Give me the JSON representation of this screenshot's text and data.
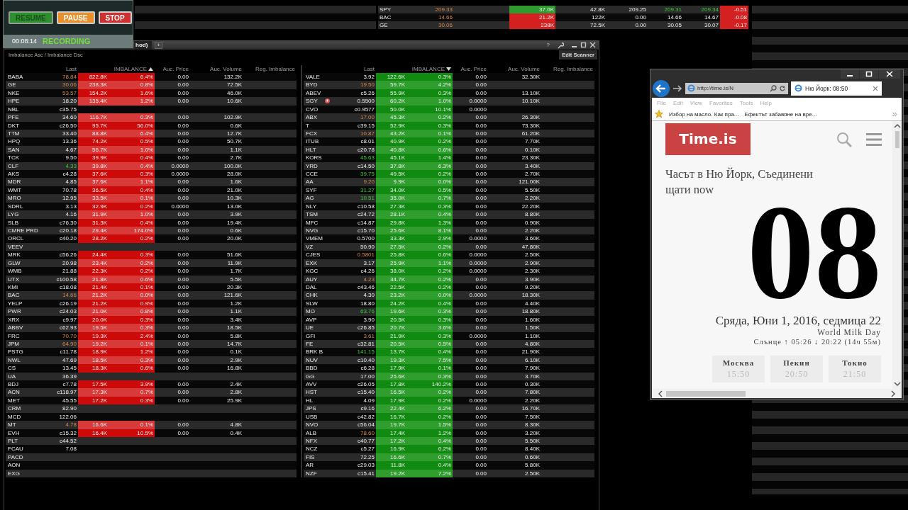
{
  "recorder": {
    "buttons": [
      {
        "label": "RESUME",
        "color": "#2f8f2f",
        "disabled": true
      },
      {
        "label": "PAUSE",
        "color": "#e8902a",
        "disabled": false
      },
      {
        "label": "STOP",
        "color": "#d03030",
        "disabled": false
      }
    ],
    "time": "00:08:14",
    "status": "RECORDING"
  },
  "ticker": {
    "rows": [
      {
        "column_1": "SPY",
        "column_2": "209.33",
        "last_down": true,
        "column_3": "37.0K",
        "buy": true,
        "column_4": "42.8K",
        "column_5": "209.25",
        "column_6": "209.31",
        "column_7": "209.34",
        "quote_up": true,
        "column_8": "-0.51"
      },
      {
        "column_1": "BAC",
        "column_2": "14.66",
        "last_down": true,
        "column_3": "21.2K",
        "buy": false,
        "column_4": "122K",
        "column_5": "0.00",
        "column_6": "14.66",
        "column_7": "14.67",
        "quote_up": false,
        "column_8": "-0.08"
      },
      {
        "column_1": "GE",
        "column_2": "30.06",
        "last_down": true,
        "column_3": "238K",
        "buy": false,
        "column_4": "72.5K",
        "column_5": "0.00",
        "column_6": "30.05",
        "column_7": "30.07",
        "quote_up": false,
        "column_8": "-0.17"
      }
    ]
  },
  "scanner": {
    "tab": "hod)",
    "new_tab": "+",
    "help": "?",
    "subtitle": "Imbalance Asc / Imbalance Dsc",
    "edit_button": "Edit Scanner",
    "tables": [
      {
        "columns": [
          "Last",
          "IMBALANCE",
          "Auc. Price",
          "Auc. Volume",
          "Reg. Imbalance"
        ],
        "ascending": true,
        "buy": false,
        "rows": [
          {
            "sym": "BABA",
            "last": "78.84",
            "up": false,
            "down": true,
            "imb": "822.8K",
            "pct": "6.4%",
            "price": "0.00",
            "vol": "132.2K"
          },
          {
            "sym": "GE",
            "last": "30.06",
            "up": false,
            "down": true,
            "imb": "238.3K",
            "pct": "0.8%",
            "price": "0.00",
            "vol": "72.5K"
          },
          {
            "sym": "NKE",
            "last": "53.57",
            "up": false,
            "down": true,
            "imb": "154.2K",
            "pct": "1.6%",
            "price": "0.00",
            "vol": "46.0K"
          },
          {
            "sym": "HPE",
            "last": "18.20",
            "up": false,
            "down": false,
            "imb": "135.4K",
            "pct": "1.2%",
            "price": "0.00",
            "vol": "10.6K"
          },
          {
            "sym": "NBL",
            "last": "c35.75",
            "up": false,
            "down": false
          },
          {
            "sym": "PFE",
            "last": "34.60",
            "up": false,
            "down": false,
            "imb": "116.7K",
            "pct": "0.3%",
            "price": "0.00",
            "vol": "102.9K"
          },
          {
            "sym": "DKT",
            "last": "c26.50",
            "up": false,
            "down": false,
            "imb": "95.7K",
            "pct": "56.0%",
            "price": "0.00",
            "vol": "0.6K"
          },
          {
            "sym": "TTM",
            "last": "33.40",
            "up": false,
            "down": false,
            "imb": "88.8K",
            "pct": "6.4%",
            "price": "0.00",
            "vol": "12.7K"
          },
          {
            "sym": "HPQ",
            "last": "13.36",
            "up": false,
            "down": false,
            "imb": "74.2K",
            "pct": "0.5%",
            "price": "0.00",
            "vol": "50.7K"
          },
          {
            "sym": "SAN",
            "last": "4.67",
            "up": false,
            "down": false,
            "imb": "56.7K",
            "pct": "1.0%",
            "price": "0.00",
            "vol": "1.1K"
          },
          {
            "sym": "TCK",
            "last": "9.50",
            "up": false,
            "down": false,
            "imb": "39.9K",
            "pct": "0.4%",
            "price": "0.00",
            "vol": "2.7K"
          },
          {
            "sym": "CLF",
            "last": "4.33",
            "up": true,
            "down": false,
            "imb": "39.8K",
            "pct": "0.4%",
            "price": "0.0000",
            "vol": "100.0K"
          },
          {
            "sym": "AKS",
            "last": "c4.28",
            "up": false,
            "down": false,
            "imb": "37.6K",
            "pct": "0.3%",
            "price": "0.0000",
            "vol": "28.0K"
          },
          {
            "sym": "MDR",
            "last": "4.85",
            "up": false,
            "down": false,
            "imb": "37.6K",
            "pct": "1.1%",
            "price": "0.00",
            "vol": "1.6K"
          },
          {
            "sym": "WMT",
            "last": "70.78",
            "up": false,
            "down": false,
            "imb": "36.5K",
            "pct": "0.4%",
            "price": "0.00",
            "vol": "21.0K"
          },
          {
            "sym": "MRO",
            "last": "12.95",
            "up": false,
            "down": false,
            "imb": "33.5K",
            "pct": "0.1%",
            "price": "0.00",
            "vol": "10.3K"
          },
          {
            "sym": "SDRL",
            "last": "3.13",
            "up": false,
            "down": false,
            "imb": "32.9K",
            "pct": "0.2%",
            "price": "0.0000",
            "vol": "13.0K"
          },
          {
            "sym": "LYG",
            "last": "4.16",
            "up": false,
            "down": false,
            "imb": "31.9K",
            "pct": "1.0%",
            "price": "0.00",
            "vol": "3.9K"
          },
          {
            "sym": "SLB",
            "last": "c76.30",
            "up": false,
            "down": false,
            "imb": "31.3K",
            "pct": "0.4%",
            "price": "0.00",
            "vol": "19.4K"
          },
          {
            "sym": "CMRE PRD",
            "last": "c20.18",
            "up": false,
            "down": false,
            "imb": "29.4K",
            "pct": "174.0%",
            "price": "0.00",
            "vol": "0.6K"
          },
          {
            "sym": "ORCL",
            "last": "c40.20",
            "up": false,
            "down": false,
            "imb": "28.2K",
            "pct": "0.2%",
            "price": "0.00",
            "vol": "20.0K"
          },
          {
            "sym": "VEEV"
          },
          {
            "sym": "MRK",
            "last": "c56.26",
            "up": false,
            "down": false,
            "imb": "24.4K",
            "pct": "0.3%",
            "price": "0.00",
            "vol": "51.6K"
          },
          {
            "sym": "GLW",
            "last": "20.98",
            "up": false,
            "down": false,
            "imb": "23.4K",
            "pct": "0.2%",
            "price": "0.00",
            "vol": "11.9K"
          },
          {
            "sym": "WMB",
            "last": "21.88",
            "up": false,
            "down": false,
            "imb": "22.3K",
            "pct": "0.2%",
            "price": "0.00",
            "vol": "1.7K"
          },
          {
            "sym": "UTX",
            "last": "c100.58",
            "up": false,
            "down": false,
            "imb": "21.8K",
            "pct": "0.6%",
            "price": "0.00",
            "vol": "5.5K"
          },
          {
            "sym": "KMI",
            "last": "c18.08",
            "up": false,
            "down": false,
            "imb": "21.4K",
            "pct": "0.1%",
            "price": "0.00",
            "vol": "20.3K"
          },
          {
            "sym": "BAC",
            "last": "14.66",
            "up": false,
            "down": true,
            "imb": "21.2K",
            "pct": "0.0%",
            "price": "0.00",
            "vol": "121.6K"
          },
          {
            "sym": "YELP",
            "last": "c26.19",
            "up": false,
            "down": false,
            "imb": "21.2K",
            "pct": "0.9%",
            "price": "0.00",
            "vol": "1.2K"
          },
          {
            "sym": "PWR",
            "last": "c24.03",
            "up": false,
            "down": false,
            "imb": "21.0K",
            "pct": "0.8%",
            "price": "0.00",
            "vol": "1.1K"
          },
          {
            "sym": "XRX",
            "last": "c9.97",
            "up": false,
            "down": false,
            "imb": "20.0K",
            "pct": "0.3%",
            "price": "0.00",
            "vol": "3.4K"
          },
          {
            "sym": "ABBV",
            "last": "c62.93",
            "up": false,
            "down": false,
            "imb": "19.5K",
            "pct": "0.3%",
            "price": "0.00",
            "vol": "18.5K"
          },
          {
            "sym": "FRC",
            "last": "70.70",
            "up": false,
            "down": true,
            "imb": "19.3K",
            "pct": "2.4%",
            "price": "0.00",
            "vol": "5.8K"
          },
          {
            "sym": "JPM",
            "last": "64.90",
            "up": false,
            "down": true,
            "imb": "19.2K",
            "pct": "0.1%",
            "price": "0.00",
            "vol": "14.7K"
          },
          {
            "sym": "PSTG",
            "last": "c11.78",
            "up": false,
            "down": false,
            "imb": "18.9K",
            "pct": "1.2%",
            "price": "0.00",
            "vol": "0.1K"
          },
          {
            "sym": "NWL",
            "last": "47.69",
            "up": false,
            "down": false,
            "imb": "18.5K",
            "pct": "0.3%",
            "price": "0.00",
            "vol": "2.9K"
          },
          {
            "sym": "CS",
            "last": "13.45",
            "up": false,
            "down": false,
            "imb": "18.3K",
            "pct": "0.6%",
            "price": "0.00",
            "vol": "16.8K"
          },
          {
            "sym": "UA",
            "last": "36.39",
            "up": false,
            "down": false
          },
          {
            "sym": "BDJ",
            "last": "c7.78",
            "up": false,
            "down": false,
            "imb": "17.5K",
            "pct": "3.9%",
            "price": "0.00",
            "vol": "2.4K"
          },
          {
            "sym": "ACN",
            "last": "c118.97",
            "up": false,
            "down": false,
            "imb": "17.3K",
            "pct": "0.7%",
            "price": "0.00",
            "vol": "2.8K"
          },
          {
            "sym": "MET",
            "last": "45.55",
            "up": false,
            "down": false,
            "imb": "17.2K",
            "pct": "0.3%",
            "price": "0.00",
            "vol": "25.9K"
          },
          {
            "sym": "CRM",
            "last": "82.90",
            "up": false,
            "down": false
          },
          {
            "sym": "MCD",
            "last": "122.06",
            "up": false,
            "down": false
          },
          {
            "sym": "MT",
            "last": "4.78",
            "up": false,
            "down": true,
            "imb": "16.6K",
            "pct": "0.1%",
            "price": "0.00",
            "vol": "4.8K"
          },
          {
            "sym": "EVH",
            "last": "c15.32",
            "up": false,
            "down": false,
            "imb": "16.4K",
            "pct": "10.5%",
            "price": "0.00",
            "vol": "0.4K"
          },
          {
            "sym": "PLT",
            "last": "c44.52",
            "up": false,
            "down": false
          },
          {
            "sym": "FCAU",
            "last": "7.08",
            "up": false,
            "down": false
          },
          {
            "sym": "PACD"
          },
          {
            "sym": "AON"
          },
          {
            "sym": "EXG"
          }
        ]
      },
      {
        "columns": [
          "Last",
          "IMBALANCE",
          "Auc. Price",
          "Auc. Volume",
          "Reg. Imbalance"
        ],
        "ascending": false,
        "buy": true,
        "rows": [
          {
            "sym": "VALE",
            "last": "3.92",
            "up": false,
            "down": false,
            "imb": "122.6K",
            "pct": "0.3%",
            "price": "0.00",
            "vol": "32.30K"
          },
          {
            "sym": "BYD",
            "last": "19.50",
            "up": false,
            "down": true,
            "imb": "59.7K",
            "pct": "4.2%",
            "price": "0.00"
          },
          {
            "sym": "ABEV",
            "last": "c5.26",
            "up": false,
            "down": false,
            "imb": "55.9K",
            "pct": "0.3%",
            "price": "0.00",
            "vol": "13.10K"
          },
          {
            "sym": "SGY",
            "alert": true,
            "last": "0.5500",
            "up": false,
            "down": false,
            "imb": "60.2K",
            "pct": "1.0%",
            "price": "0.0000",
            "vol": "10.10K"
          },
          {
            "sym": "CVO",
            "last": "c0.9577",
            "up": false,
            "down": false,
            "imb": "50.0K",
            "pct": "10.1%",
            "price": "0.0000"
          },
          {
            "sym": "ABX",
            "last": "17.00",
            "up": false,
            "down": true,
            "imb": "45.3K",
            "pct": "0.2%",
            "price": "0.00",
            "vol": "26.30K"
          },
          {
            "sym": "T",
            "last": "c39.15",
            "up": false,
            "down": false,
            "imb": "52.9K",
            "pct": "0.3%",
            "price": "0.00",
            "vol": "73.30K"
          },
          {
            "sym": "FCX",
            "last": "10.87",
            "up": false,
            "down": true,
            "imb": "43.2K",
            "pct": "0.1%",
            "price": "0.00",
            "vol": "61.20K"
          },
          {
            "sym": "ITUB",
            "last": "c8.01",
            "up": false,
            "down": false,
            "imb": "40.9K",
            "pct": "0.2%",
            "price": "0.00",
            "vol": "7.70K"
          },
          {
            "sym": "HLT",
            "last": "c20.78",
            "up": false,
            "down": false,
            "imb": "40.8K",
            "pct": "0.6%",
            "price": "0.00",
            "vol": "0.10K"
          },
          {
            "sym": "KORS",
            "last": "45.63",
            "up": true,
            "down": false,
            "imb": "45.1K",
            "pct": "1.4%",
            "price": "0.00",
            "vol": "23.30K"
          },
          {
            "sym": "YRD",
            "last": "c14.50",
            "up": false,
            "down": false,
            "imb": "37.8K",
            "pct": "6.3%",
            "price": "0.00",
            "vol": "3.40K"
          },
          {
            "sym": "CCE",
            "last": "39.75",
            "up": true,
            "down": false,
            "imb": "49.5K",
            "pct": "0.2%",
            "price": "0.00",
            "vol": "2.70K"
          },
          {
            "sym": "AA",
            "last": "9.20",
            "up": false,
            "down": true,
            "imb": "9.9K",
            "pct": "0.0%",
            "price": "0.00",
            "vol": "121.00K"
          },
          {
            "sym": "SYF",
            "last": "31.27",
            "up": true,
            "down": false,
            "imb": "34.0K",
            "pct": "0.5%",
            "price": "0.00",
            "vol": "5.50K"
          },
          {
            "sym": "AG",
            "last": "10.51",
            "up": true,
            "down": false,
            "imb": "35.0K",
            "pct": "0.7%",
            "price": "0.00",
            "vol": "2.20K"
          },
          {
            "sym": "NLY",
            "last": "c10.58",
            "up": false,
            "down": false,
            "imb": "27.3K",
            "pct": "0.3%",
            "price": "0.00",
            "vol": "22.20K"
          },
          {
            "sym": "TSM",
            "last": "c24.72",
            "up": false,
            "down": false,
            "imb": "28.1K",
            "pct": "0.4%",
            "price": "0.00",
            "vol": "8.80K"
          },
          {
            "sym": "MFC",
            "last": "c14.87",
            "up": false,
            "down": false,
            "imb": "29.8K",
            "pct": "1.3%",
            "price": "0.00",
            "vol": "0.90K"
          },
          {
            "sym": "NVG",
            "last": "c15.70",
            "up": false,
            "down": false,
            "imb": "25.6K",
            "pct": "8.1%",
            "price": "0.00",
            "vol": "2.20K"
          },
          {
            "sym": "VMEM",
            "last": "0.5700",
            "up": false,
            "down": false,
            "imb": "33.3K",
            "pct": "2.9%",
            "price": "0.0000",
            "vol": "3.60K"
          },
          {
            "sym": "VZ",
            "last": "50.90",
            "up": false,
            "down": false,
            "imb": "27.5K",
            "pct": "0.2%",
            "price": "0.00",
            "vol": "47.80K"
          },
          {
            "sym": "CJES",
            "last": "0.5801",
            "up": false,
            "down": true,
            "imb": "25.8K",
            "pct": "0.6%",
            "price": "0.0000",
            "vol": "2.50K"
          },
          {
            "sym": "EXK",
            "last": "3.17",
            "up": false,
            "down": false,
            "imb": "25.9K",
            "pct": "1.1%",
            "price": "0.0000",
            "vol": "2.90K"
          },
          {
            "sym": "KGC",
            "last": "c4.26",
            "up": false,
            "down": false,
            "imb": "38.0K",
            "pct": "0.2%",
            "price": "0.0000",
            "vol": "2.30K"
          },
          {
            "sym": "AUY",
            "last": "4.23",
            "up": false,
            "down": true,
            "imb": "34.7K",
            "pct": "0.2%",
            "price": "0.00",
            "vol": "3.90K"
          },
          {
            "sym": "DAL",
            "last": "c43.46",
            "up": false,
            "down": false,
            "imb": "22.5K",
            "pct": "0.2%",
            "price": "0.00",
            "vol": "9.20K"
          },
          {
            "sym": "CHK",
            "last": "4.30",
            "up": false,
            "down": false,
            "imb": "23.2K",
            "pct": "0.0%",
            "price": "0.0000",
            "vol": "18.30K"
          },
          {
            "sym": "SLW",
            "last": "18.80",
            "up": false,
            "down": false,
            "imb": "24.2K",
            "pct": "0.4%",
            "price": "0.00",
            "vol": "4.40K"
          },
          {
            "sym": "MO",
            "last": "63.76",
            "up": true,
            "down": false,
            "imb": "19.6K",
            "pct": "0.3%",
            "price": "0.00",
            "vol": "18.80K"
          },
          {
            "sym": "AVP",
            "last": "3.90",
            "up": false,
            "down": false,
            "imb": "20.5K",
            "pct": "0.3%",
            "price": "0.00",
            "vol": "1.60K"
          },
          {
            "sym": "UE",
            "last": "c26.85",
            "up": false,
            "down": false,
            "imb": "20.7K",
            "pct": "3.6%",
            "price": "0.00",
            "vol": "1.50K"
          },
          {
            "sym": "GFI",
            "last": "3.61",
            "up": false,
            "down": true,
            "imb": "21.9K",
            "pct": "0.3%",
            "price": "0.0000",
            "vol": "1.10K"
          },
          {
            "sym": "FE",
            "last": "c32.81",
            "up": false,
            "down": false,
            "imb": "20.5K",
            "pct": "0.5%",
            "price": "0.00",
            "vol": "4.80K"
          },
          {
            "sym": "BRK B",
            "last": "141.15",
            "up": true,
            "down": false,
            "imb": "13.7K",
            "pct": "0.4%",
            "price": "0.00",
            "vol": "21.90K"
          },
          {
            "sym": "NUV",
            "last": "c10.40",
            "up": false,
            "down": false,
            "imb": "19.3K",
            "pct": "7.5%",
            "price": "0.00",
            "vol": "6.10K"
          },
          {
            "sym": "BBD",
            "last": "c6.28",
            "up": false,
            "down": false,
            "imb": "17.9K",
            "pct": "0.1%",
            "price": "0.00",
            "vol": "7.90K"
          },
          {
            "sym": "GG",
            "last": "17.00",
            "up": false,
            "down": false,
            "imb": "25.6K",
            "pct": "0.3%",
            "price": "0.00",
            "vol": "3.70K"
          },
          {
            "sym": "AVV",
            "last": "c26.05",
            "up": false,
            "down": false,
            "imb": "17.8K",
            "pct": "140.2%",
            "price": "0.00",
            "vol": "0.30K"
          },
          {
            "sym": "HST",
            "last": "c15.40",
            "up": false,
            "down": false,
            "imb": "16.5K",
            "pct": "0.2%",
            "price": "0.00",
            "vol": "7.80K"
          },
          {
            "sym": "HL",
            "last": "4.09",
            "up": false,
            "down": false,
            "imb": "17.9K",
            "pct": "0.2%",
            "price": "0.0000",
            "vol": "2.20K"
          },
          {
            "sym": "JPS",
            "last": "c9.16",
            "up": false,
            "down": false,
            "imb": "22.4K",
            "pct": "6.2%",
            "price": "0.00",
            "vol": "16.70K"
          },
          {
            "sym": "USB",
            "last": "c42.82",
            "up": false,
            "down": false,
            "imb": "16.7K",
            "pct": "0.2%",
            "price": "0.00",
            "vol": "7.50K"
          },
          {
            "sym": "NVO",
            "last": "c56.04",
            "up": false,
            "down": false,
            "imb": "19.7K",
            "pct": "1.5%",
            "price": "0.00",
            "vol": "8.30K"
          },
          {
            "sym": "ALB",
            "last": "78.60",
            "up": false,
            "down": true,
            "imb": "17.4K",
            "pct": "1.2%",
            "price": "0.00",
            "vol": "3.20K"
          },
          {
            "sym": "NFX",
            "last": "c40.77",
            "up": false,
            "down": false,
            "imb": "17.2K",
            "pct": "0.4%",
            "price": "0.00",
            "vol": "5.50K"
          },
          {
            "sym": "NCZ",
            "last": "c5.27",
            "up": false,
            "down": false,
            "imb": "16.9K",
            "pct": "6.2%",
            "price": "0.00",
            "vol": "8.40K"
          },
          {
            "sym": "FIS",
            "last": "72.25",
            "up": false,
            "down": false,
            "imb": "16.6K",
            "pct": "0.7%",
            "price": "0.00",
            "vol": "0.60K"
          },
          {
            "sym": "AR",
            "last": "c29.03",
            "up": false,
            "down": false,
            "imb": "11.8K",
            "pct": "0.4%",
            "price": "0.00",
            "vol": "5.80K"
          },
          {
            "sym": "NZF",
            "last": "c15.41",
            "up": false,
            "down": false,
            "imb": "19.2K",
            "pct": "7.2%",
            "price": "0.00",
            "vol": "2.50K"
          }
        ]
      }
    ]
  },
  "browser": {
    "address": "http://time.is/N",
    "tab": "Ню Йорк: 08:50",
    "menu": [
      "File",
      "Edit",
      "View",
      "Favorites",
      "Tools",
      "Help"
    ],
    "favorites": [
      "Избор на масло. Как пра...",
      "Ефектът забавяне на вре..."
    ],
    "page": {
      "logo": "Time.is",
      "heading": "Часът в Ню Йорк, Съединени щати now",
      "hour": "08",
      "date": "Сряда, Юни 1, 2016, седмица 22",
      "holiday": "World Milk Day",
      "sun": "Слънце ↑ 05:26 ↓ 20:22 (14ч 55м)",
      "cities": [
        {
          "name": "Москва",
          "time": "15:50"
        },
        {
          "name": "Пекин",
          "time": "20:50"
        },
        {
          "name": "Токио",
          "time": "21:50"
        }
      ]
    }
  }
}
